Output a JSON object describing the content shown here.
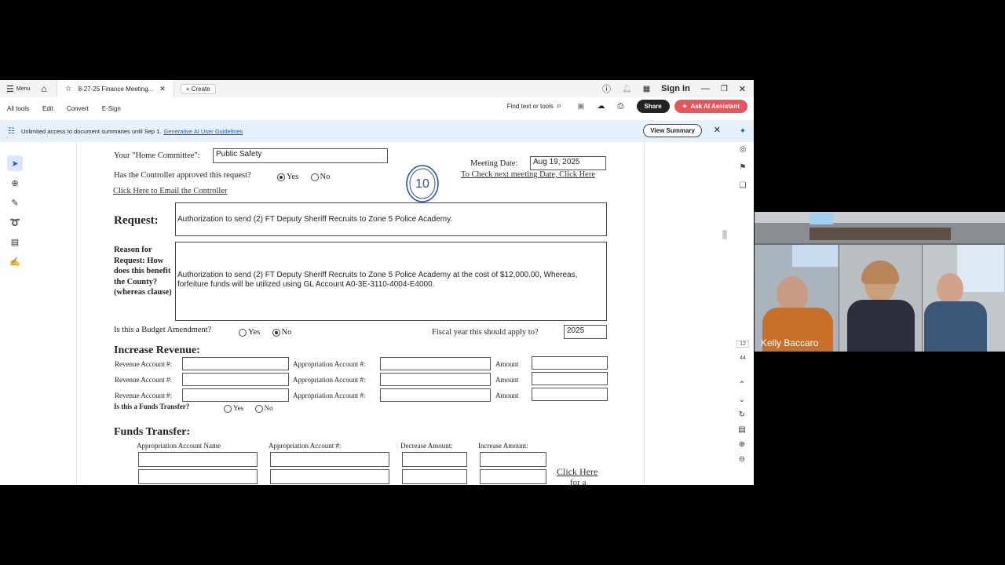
{
  "titlebar": {
    "menu_label": "Menu",
    "tab_title": "8-27-25 Finance Meeting...",
    "create_label": "Create",
    "sign_in": "Sign in"
  },
  "toolbar": {
    "items": [
      "All tools",
      "Edit",
      "Convert",
      "E-Sign"
    ],
    "find_placeholder": "Find text or tools",
    "share_label": "Share",
    "ai_label": "Ask AI Assistant"
  },
  "banner": {
    "text": "Unlimited access to document summaries until Sep 1.",
    "link": "Generative AI User Guidelines",
    "view_summary": "View Summary"
  },
  "form": {
    "home_committee_label": "Your \"Home Committee\":",
    "home_committee_value": "Public Safety",
    "controller_question": "Has the Controller approved this request?",
    "yes": "Yes",
    "no": "No",
    "email_controller_link": "Click Here to Email the Controller",
    "meeting_date_label": "Meeting Date:",
    "meeting_date_value": "Aug 19, 2025",
    "next_meeting_link": "To Check next meeting Date, Click Here",
    "request_heading": "Request:",
    "request_value": "Authorization to send (2) FT Deputy Sheriff Recruits to Zone 5 Police Academy.",
    "reason_label": "Reason for Request: How does this benefit the County? (whereas clause)",
    "reason_value": "Authorization to send (2) FT Deputy Sheriff Recruits to Zone 5 Police Academy at the cost of $12,000.00, Whereas, forfeiture funds will be utilized using GL Account  A0-3E-3110-4004-E4000.",
    "budget_amendment_question": "Is this a Budget Amendment?",
    "fiscal_year_label": "Fiscal year this should apply to?",
    "fiscal_year_value": "2025",
    "increase_revenue_heading": "Increase Revenue:",
    "revenue_account_label": "Revenue Account #:",
    "appropriation_account_label": "Appropriation Account #:",
    "amount_label": "Amount",
    "funds_transfer_question": "Is this a Funds Transfer?",
    "funds_transfer_heading": "Funds Transfer:",
    "col_name": "Appropriation Account Name",
    "col_number": "Appropriation Account #:",
    "col_decrease": "Decrease Amount:",
    "col_increase": "Increase Amount:",
    "click_here": "Click Here",
    "for_a": "for a",
    "stamp": "10"
  },
  "page_numbers": {
    "current": "12",
    "total": "44"
  },
  "video": {
    "participant_name": "Kelly Baccaro"
  }
}
